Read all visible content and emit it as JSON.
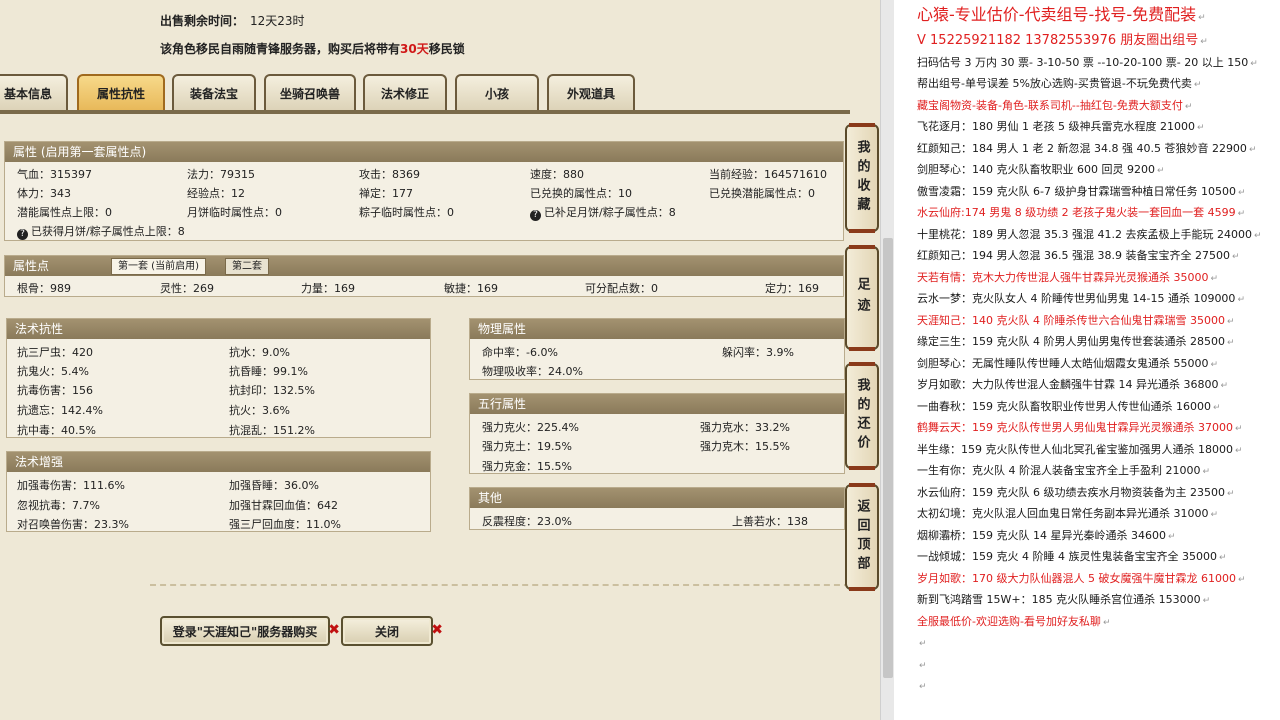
{
  "sale": {
    "remaining_label": "出售剩余时间：",
    "remaining_value": "12天23时",
    "migrate_pre": "该角色移民自雨随青锋服务器，购买后将带有",
    "migrate_days": "30天",
    "migrate_post": "移民锁"
  },
  "tabs": [
    "基本信息",
    "属性抗性",
    "装备法宝",
    "坐骑召唤兽",
    "法术修正",
    "小孩",
    "外观道具"
  ],
  "active_tab": "属性抗性",
  "attr": {
    "title": "属性 (启用第一套属性点)",
    "rows": [
      [
        "气血：315397",
        "法力：79315",
        "攻击：8369",
        "速度：880",
        "当前经验：164571610"
      ],
      [
        "体力：343",
        "经验点：12",
        "禅定：177",
        "已兑换的属性点：10",
        "已兑换潜能属性点：0"
      ],
      [
        "潜能属性点上限：0",
        "月饼临时属性点：0",
        "粽子临时属性点：0",
        "已补足月饼/粽子属性点：8",
        ""
      ],
      [
        "已获得月饼/粽子属性点上限：8",
        "",
        "",
        "",
        ""
      ]
    ]
  },
  "points": {
    "title": "属性点",
    "tab1": "第一套 (当前启用)",
    "tab2": "第二套",
    "row": [
      "根骨：989",
      "灵性：269",
      "力量：169",
      "敏捷：169",
      "可分配点数：0",
      "定力：169"
    ]
  },
  "resist": {
    "title": "法术抗性",
    "rows": [
      [
        "抗三尸虫：420",
        "抗水：9.0%"
      ],
      [
        "抗鬼火：5.4%",
        "抗昏睡：99.1%"
      ],
      [
        "抗毒伤害：156",
        "抗封印：132.5%"
      ],
      [
        "抗遗忘：142.4%",
        "抗火：3.6%"
      ],
      [
        "抗中毒：40.5%",
        "抗混乱：151.2%"
      ]
    ]
  },
  "enhance": {
    "title": "法术增强",
    "rows": [
      [
        "加强毒伤害：111.6%",
        "加强昏睡：36.0%"
      ],
      [
        "忽视抗毒：7.7%",
        "加强甘霖回血值：642"
      ],
      [
        "对召唤兽伤害：23.3%",
        "强三尸回血度：11.0%"
      ]
    ]
  },
  "physical": {
    "title": "物理属性",
    "rows": [
      [
        "命中率：-6.0%",
        "躲闪率：3.9%"
      ],
      [
        "物理吸收率：24.0%",
        ""
      ]
    ]
  },
  "five": {
    "title": "五行属性",
    "rows": [
      [
        "强力克火：225.4%",
        "强力克水：33.2%"
      ],
      [
        "强力克土：19.5%",
        "强力克木：15.5%"
      ],
      [
        "强力克金：15.5%",
        ""
      ]
    ]
  },
  "other": {
    "title": "其他",
    "rows": [
      [
        "反震程度：23.0%",
        "上善若水：138"
      ]
    ]
  },
  "buttons": {
    "login": "登录\"天涯知己\"服务器购买",
    "close": "关闭",
    "close_mark": "✖"
  },
  "side": [
    "我的收藏",
    "足迹",
    "我的还价",
    "返回顶部"
  ],
  "right_lines": [
    {
      "t": "心猿-专业估价-代卖组号-找号-免费配装",
      "s": "big"
    },
    {
      "t": "V 15225921182   13782553976 朋友圈出组号",
      "s": "v"
    },
    {
      "t": "扫码估号 3 万内 30 票- 3-10-50 票  --10-20-100 票- 20 以上 150",
      "s": ""
    },
    {
      "t": "帮出组号-单号误差 5%放心选购-买贵管退-不玩免费代卖",
      "s": ""
    },
    {
      "t": "藏宝阁物资-装备-角色-联系司机--抽红包-免费大额支付",
      "s": "r"
    },
    {
      "t": "飞花逐月：180 男仙 1 老孩 5 级神兵雷克水程度 21000",
      "s": ""
    },
    {
      "t": "红颜知己：184 男人 1 老 2 新忽混 34.8 强 40.5 苍狼妙音 22900",
      "s": ""
    },
    {
      "t": "剑胆琴心：140 克火队畜牧职业 600 回灵 9200",
      "s": ""
    },
    {
      "t": "傲雪凌霜：159 克火队 6-7 级护身甘霖瑞雪种植日常任务 10500",
      "s": ""
    },
    {
      "t": "水云仙府:174 男鬼 8 级功绩 2 老孩子鬼火装一套回血一套 4599",
      "s": "r"
    },
    {
      "t": "十里桃花：189 男人忽混 35.3 强混 41.2 去疾孟极上手能玩 24000",
      "s": ""
    },
    {
      "t": "红颜知己：194 男人忽混 36.5 强混 38.9 装备宝宝齐全 27500",
      "s": ""
    },
    {
      "t": "天若有情：克木大力传世混人强牛甘霖异光灵猴通杀 35000",
      "s": "r"
    },
    {
      "t": "云水一梦：克火队女人 4 阶睡传世男仙男鬼 14-15 通杀 109000",
      "s": ""
    },
    {
      "t": "天涯知己：140 克火队 4 阶睡杀传世六合仙鬼甘霖瑞雪 35000",
      "s": "r"
    },
    {
      "t": "缘定三生：159 克火队 4 阶男人男仙男鬼传世套装通杀 28500",
      "s": ""
    },
    {
      "t": "剑胆琴心：无属性睡队传世睡人太皓仙烟霞女鬼通杀 55000",
      "s": ""
    },
    {
      "t": "岁月如歌：大力队传世混人金麟强牛甘霖 14 异光通杀 36800",
      "s": ""
    },
    {
      "t": "一曲春秋：159 克火队畜牧职业传世男人传世仙通杀 16000",
      "s": ""
    },
    {
      "t": "鹤舞云天：159 克火队传世男人男仙鬼甘霖异光灵猴通杀 37000",
      "s": "r"
    },
    {
      "t": "半生缘：159 克火队传世人仙北冥孔雀宝鉴加强男人通杀 18000",
      "s": ""
    },
    {
      "t": "一生有你：克火队 4 阶混人装备宝宝齐全上手盈利 21000",
      "s": ""
    },
    {
      "t": "水云仙府：159 克火队 6 级功绩去疾水月物资装备为主 23500",
      "s": ""
    },
    {
      "t": "太初幻境：克火队混人回血鬼日常任务副本异光通杀 31000",
      "s": ""
    },
    {
      "t": "烟柳灞桥：159 克火队 14 星异光秦岭通杀 34600",
      "s": ""
    },
    {
      "t": "一战倾城：159 克火 4 阶睡 4 族灵性鬼装备宝宝齐全 35000",
      "s": ""
    },
    {
      "t": "岁月如歌：170 级大力队仙器混人 5 破女魔强牛魔甘霖龙 61000",
      "s": "r"
    },
    {
      "t": "新到飞鸿踏雪 15W+：185 克火队睡杀宫位通杀 153000",
      "s": ""
    },
    {
      "t": "全服最低价-欢迎选购-看号加好友私聊",
      "s": "r"
    },
    {
      "t": "",
      "s": ""
    },
    {
      "t": "",
      "s": ""
    },
    {
      "t": "",
      "s": ""
    }
  ],
  "paragraph_mark": "↵"
}
